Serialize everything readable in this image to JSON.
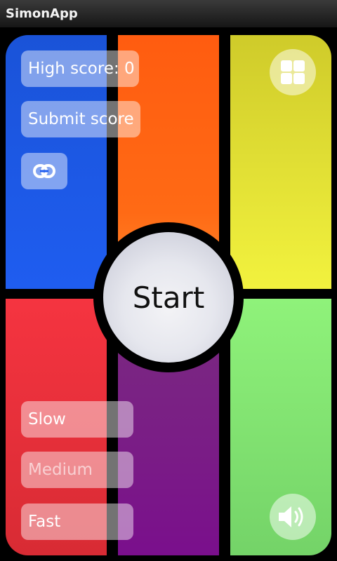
{
  "app": {
    "title": "SimonApp"
  },
  "buttons": {
    "high_score": "High score: 0",
    "submit_score": "Submit score",
    "start": "Start",
    "slow": "Slow",
    "medium": "Medium",
    "fast": "Fast"
  },
  "icons": {
    "link": "link-icon",
    "menu": "grid-menu-icon",
    "sound": "speaker-icon"
  },
  "colors": {
    "blue": "#1f5df0",
    "orange": "#ff6a15",
    "yellow": "#f2f23e",
    "red": "#f53440",
    "purple": "#7a1c86",
    "green": "#8ff27a"
  }
}
